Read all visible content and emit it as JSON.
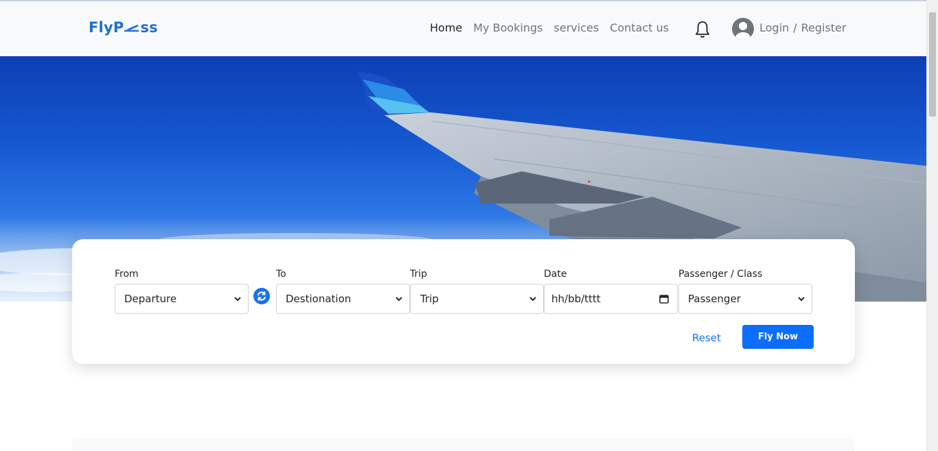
{
  "brand": {
    "text_before": "FlyP",
    "text_after": "ss"
  },
  "nav": {
    "home": "Home",
    "bookings": "My Bookings",
    "services": "services",
    "contact": "Contact us"
  },
  "auth": {
    "login": "Login",
    "separator": "/",
    "register": "Register"
  },
  "search": {
    "from_label": "From",
    "from_value": "Departure",
    "to_label": "To",
    "to_value": "Destionation",
    "trip_label": "Trip",
    "trip_value": "Trip",
    "date_label": "Date",
    "date_value": "hh/bb/tttt",
    "passenger_label": "Passenger / Class",
    "passenger_value": "Passenger"
  },
  "actions": {
    "reset": "Reset",
    "fly_now": "Fly Now"
  },
  "colors": {
    "brand": "#1f6fd6",
    "primary": "#0d6efd",
    "link": "#1a73e8"
  },
  "icons": {
    "bell": "bell-icon",
    "avatar": "user-avatar-icon",
    "swap": "swap-icon",
    "calendar": "calendar-icon",
    "chevron": "chevron-down-icon"
  }
}
